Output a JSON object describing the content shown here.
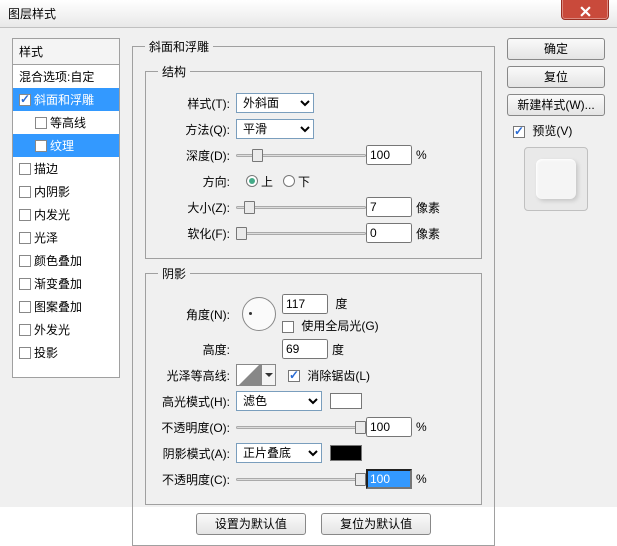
{
  "title": "图层样式",
  "sidebar": {
    "header": "样式",
    "items": [
      {
        "label": "混合选项:自定",
        "checked": null
      },
      {
        "label": "斜面和浮雕",
        "checked": true,
        "selected": true
      },
      {
        "label": "等高线",
        "checked": false,
        "indent": true
      },
      {
        "label": "纹理",
        "checked": false,
        "indent": true,
        "selected": true
      },
      {
        "label": "描边",
        "checked": false
      },
      {
        "label": "内阴影",
        "checked": false
      },
      {
        "label": "内发光",
        "checked": false
      },
      {
        "label": "光泽",
        "checked": false
      },
      {
        "label": "颜色叠加",
        "checked": false
      },
      {
        "label": "渐变叠加",
        "checked": false
      },
      {
        "label": "图案叠加",
        "checked": false
      },
      {
        "label": "外发光",
        "checked": false
      },
      {
        "label": "投影",
        "checked": false
      }
    ]
  },
  "bevel": {
    "group_label": "斜面和浮雕",
    "structure": {
      "label": "结构",
      "style": {
        "label": "样式(T):",
        "value": "外斜面"
      },
      "technique": {
        "label": "方法(Q):",
        "value": "平滑"
      },
      "depth": {
        "label": "深度(D):",
        "value": "100",
        "unit": "%",
        "pos": 12
      },
      "direction": {
        "label": "方向:",
        "up": "上",
        "down": "下",
        "selected": "up"
      },
      "size": {
        "label": "大小(Z):",
        "value": "7",
        "unit": "像素",
        "pos": 6
      },
      "soften": {
        "label": "软化(F):",
        "value": "0",
        "unit": "像素",
        "pos": 0
      }
    },
    "shading": {
      "label": "阴影",
      "angle": {
        "label": "角度(N):",
        "value": "117",
        "unit": "度"
      },
      "global": {
        "label": "使用全局光(G)",
        "checked": false
      },
      "altitude": {
        "label": "高度:",
        "value": "69",
        "unit": "度"
      },
      "gloss": {
        "label": "光泽等高线:",
        "aa": {
          "label": "消除锯齿(L)",
          "checked": true
        }
      },
      "hmode": {
        "label": "高光模式(H):",
        "value": "滤色",
        "swatch": "#ffffff"
      },
      "hopacity": {
        "label": "不透明度(O):",
        "value": "100",
        "unit": "%",
        "pos": 100
      },
      "smode": {
        "label": "阴影模式(A):",
        "value": "正片叠底",
        "swatch": "#000000"
      },
      "sopacity": {
        "label": "不透明度(C):",
        "value": "100",
        "unit": "%",
        "pos": 100,
        "selected": true
      }
    },
    "defaults": {
      "set": "设置为默认值",
      "reset": "复位为默认值"
    }
  },
  "right": {
    "ok": "确定",
    "cancel": "复位",
    "new": "新建样式(W)...",
    "preview": {
      "label": "预览(V)",
      "checked": true
    }
  }
}
